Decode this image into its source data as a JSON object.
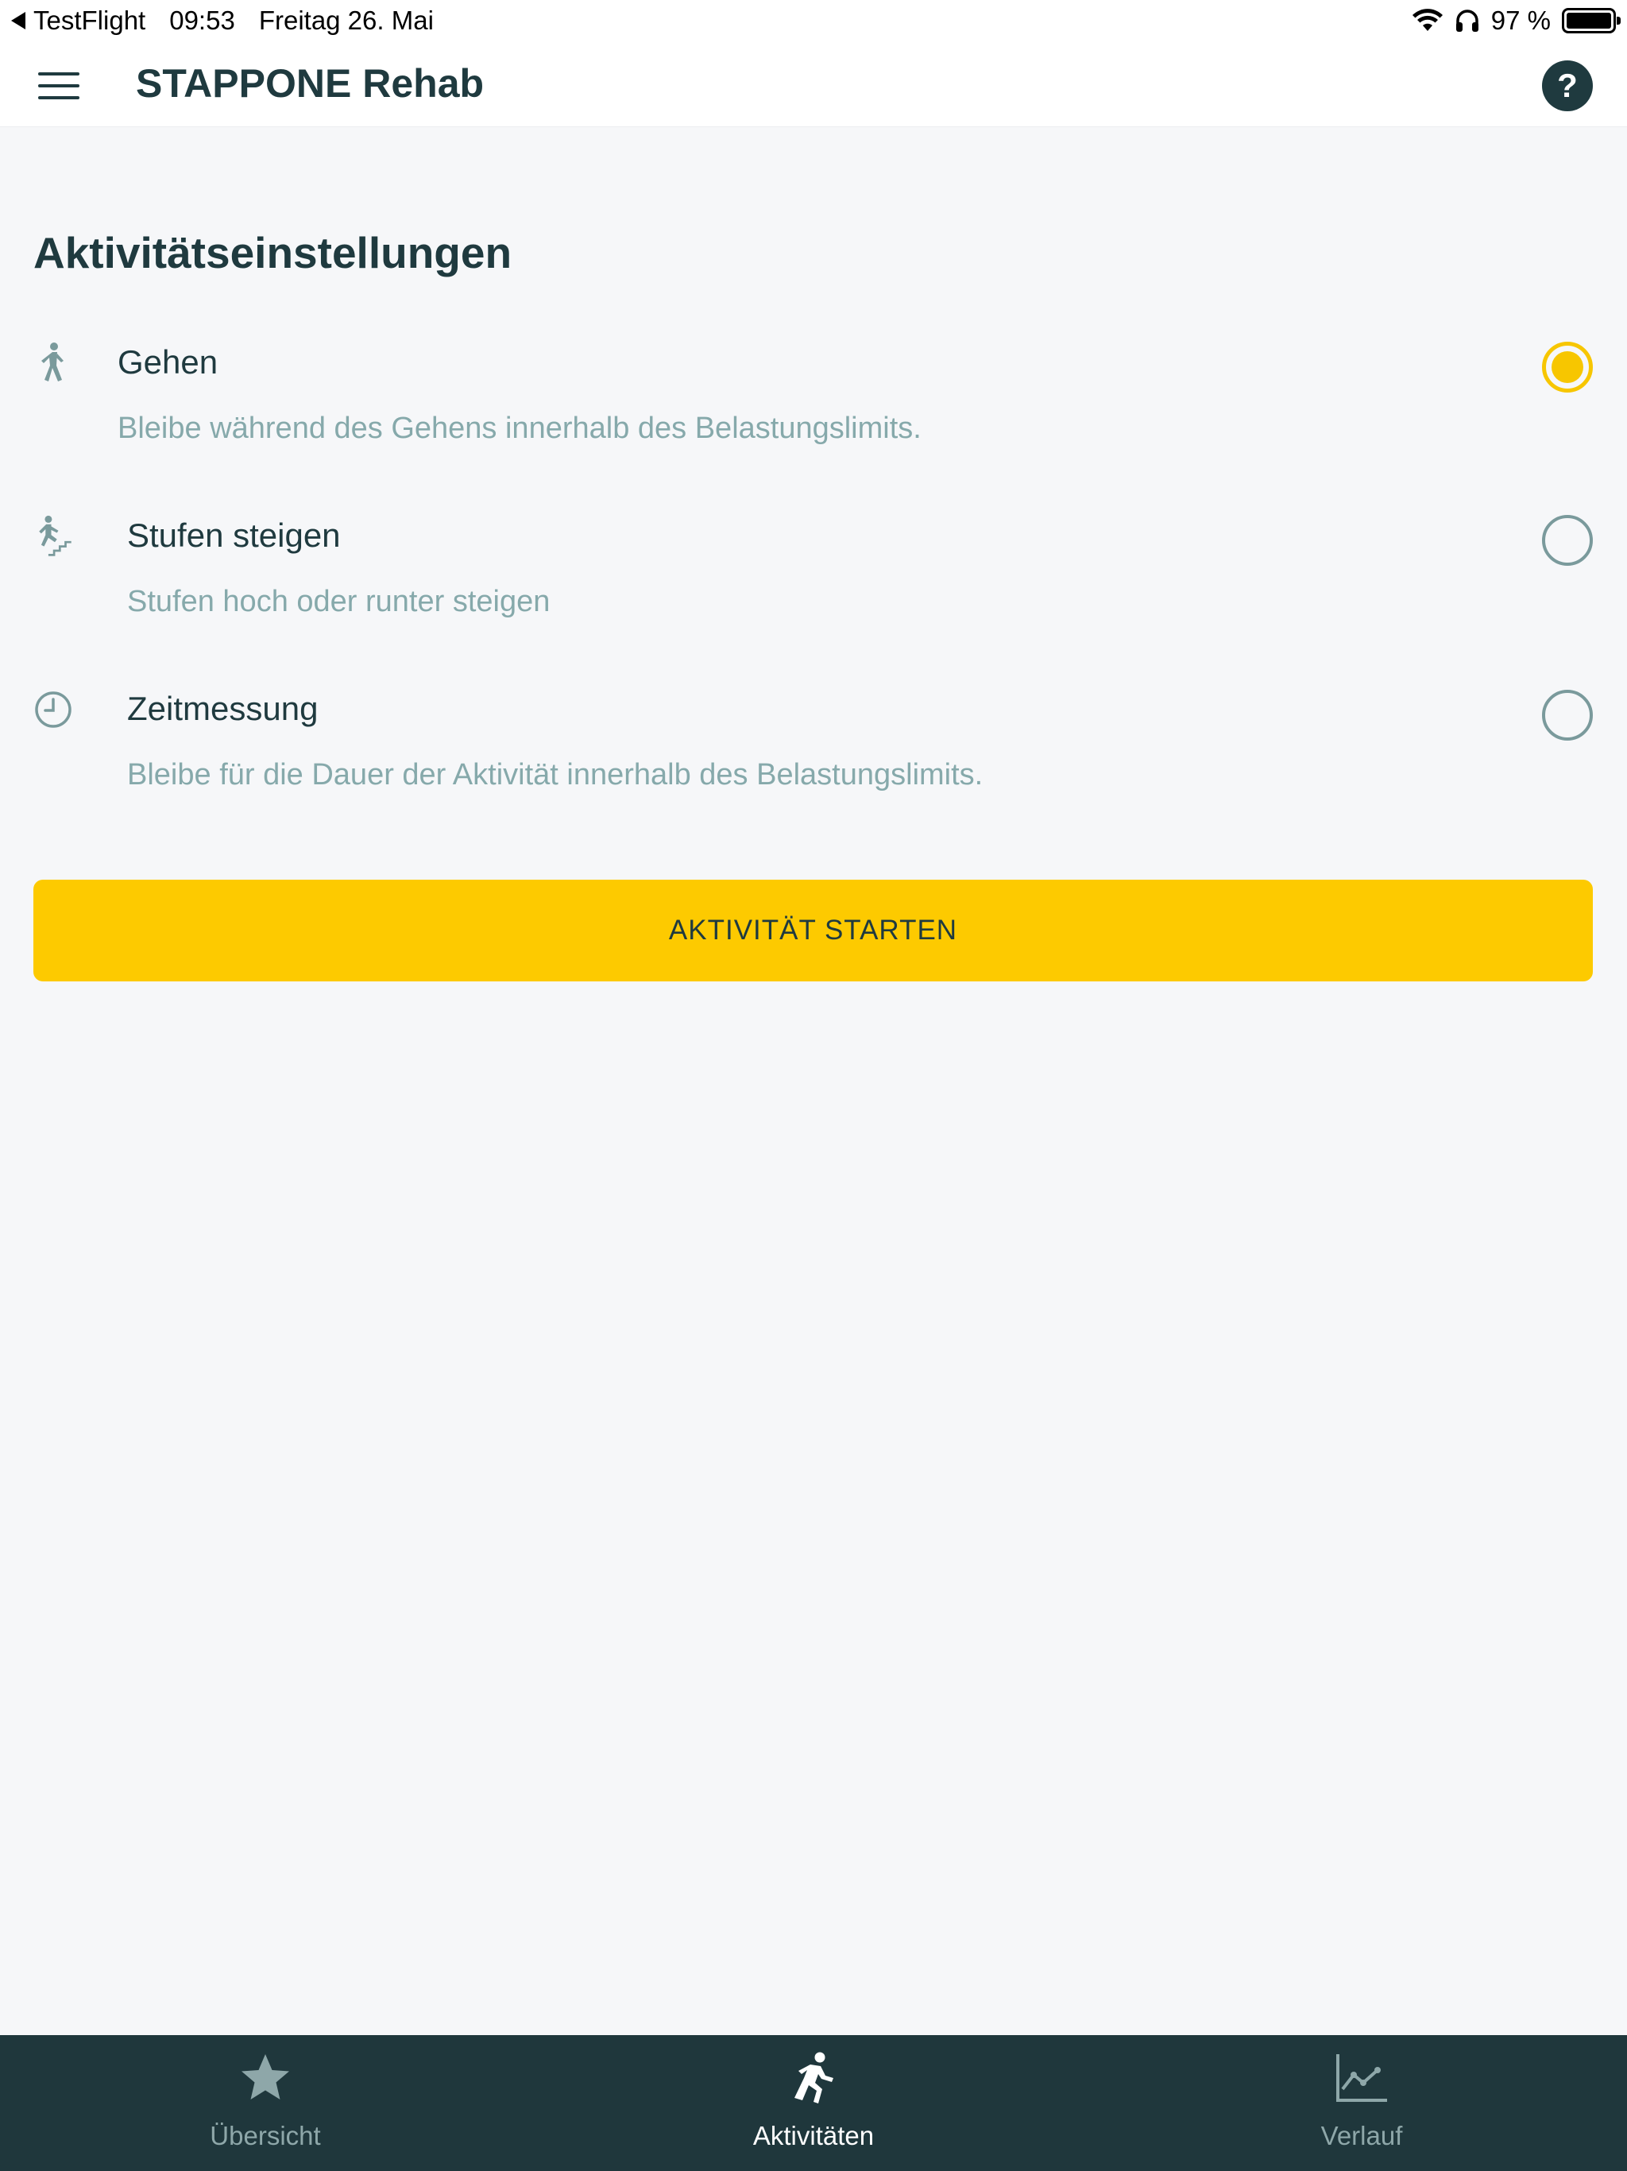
{
  "status_bar": {
    "back_app": "TestFlight",
    "time": "09:53",
    "date": "Freitag 26. Mai",
    "battery": "97 %"
  },
  "header": {
    "title": "STAPPONE Rehab",
    "help_label": "?"
  },
  "section": {
    "title": "Aktivitätseinstellungen"
  },
  "options": [
    {
      "icon": "walking-icon",
      "label": "Gehen",
      "description": "Bleibe während des Gehens innerhalb des Belastungslimits.",
      "selected": true
    },
    {
      "icon": "stairs-icon",
      "label": "Stufen steigen",
      "description": "Stufen hoch oder runter steigen",
      "selected": false
    },
    {
      "icon": "clock-icon",
      "label": "Zeitmessung",
      "description": "Bleibe für die Dauer der Aktivität innerhalb des Belastungslimits.",
      "selected": false
    }
  ],
  "start_button": {
    "label": "AKTIVITÄT STARTEN"
  },
  "tabs": [
    {
      "icon": "star-icon",
      "label": "Übersicht",
      "active": false
    },
    {
      "icon": "running-icon",
      "label": "Aktivitäten",
      "active": true
    },
    {
      "icon": "chart-icon",
      "label": "Verlauf",
      "active": false
    }
  ],
  "colors": {
    "accent": "#fdca00",
    "dark": "#1f373c",
    "muted_text": "#86a9ab"
  }
}
